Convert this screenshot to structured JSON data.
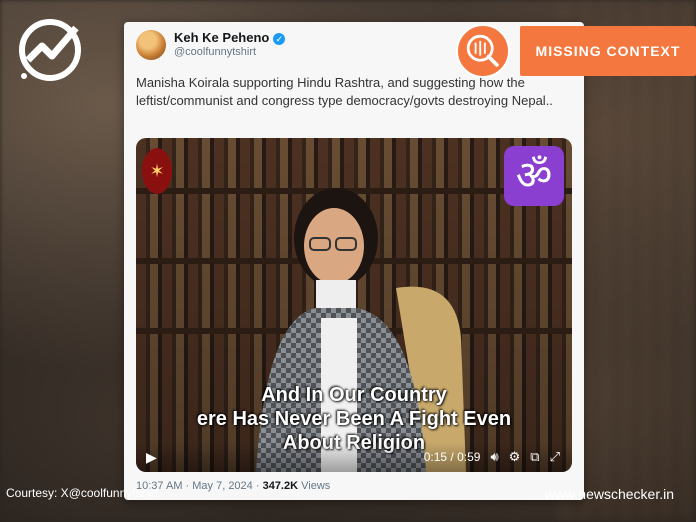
{
  "tweet": {
    "display_name": "Keh Ke Peheno",
    "handle": "@coolfunnytshirt",
    "text": "Manisha Koirala supporting Hindu Rashtra, and suggesting how the leftist/communist and congress type democracy/govts destroying Nepal..",
    "meta_time": "10:37 AM · May 7, 2024 · ",
    "meta_views_count": "347.2K",
    "meta_views_label": " Views"
  },
  "video": {
    "caption_line1": "And In Our Country",
    "caption_line2": "ere Has Never Been A Fight Even",
    "caption_line3": "About Religion",
    "time": "0:15 / 0:59",
    "om_symbol": "ॐ"
  },
  "badge": {
    "label": "MISSING CONTEXT",
    "color": "#f3773e"
  },
  "footer": {
    "courtesy": "Courtesy: X@coolfunnytshirt",
    "site": "www.newschecker.in"
  },
  "icons": {
    "logo": "newschecker-logo-icon",
    "verified": "verified-badge-icon",
    "play": "play-icon",
    "volume": "volume-icon",
    "settings": "gear-icon",
    "pip": "picture-in-picture-icon",
    "fullscreen": "fullscreen-icon",
    "missing_context": "magnifier-icon"
  }
}
